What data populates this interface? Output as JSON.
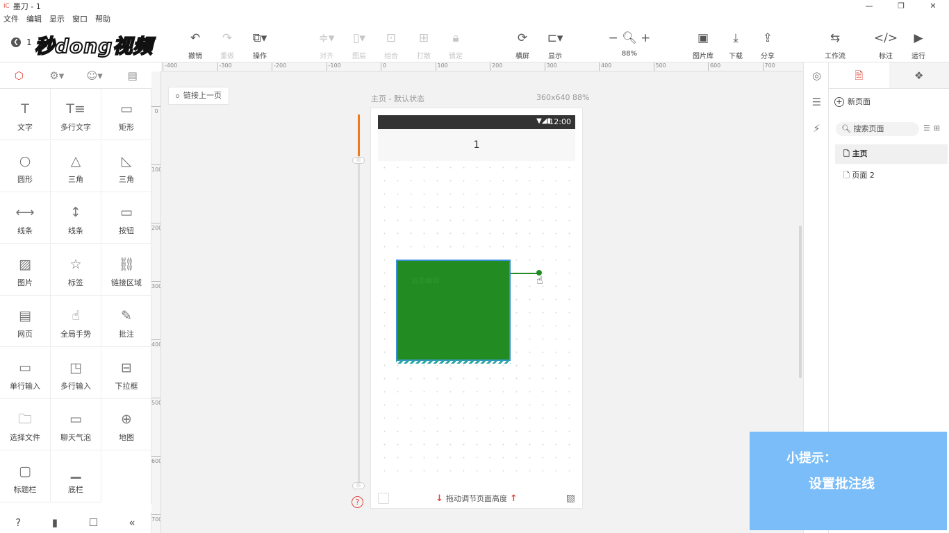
{
  "window": {
    "title": "墨刀 - 1",
    "logo": "iC",
    "minimize": "—",
    "restore": "❐",
    "close": "✕"
  },
  "menu": [
    "文件",
    "编辑",
    "显示",
    "窗口",
    "帮助"
  ],
  "brand": "秒dong视频",
  "page_number": "1",
  "toolbar": [
    {
      "label": "撤销",
      "icon": "↶",
      "disabled": false
    },
    {
      "label": "重做",
      "icon": "↷",
      "disabled": true
    },
    {
      "label": "操作",
      "icon": "⧉▾",
      "disabled": false
    },
    {
      "label": "对齐",
      "icon": "≑▾",
      "disabled": true
    },
    {
      "label": "图层",
      "icon": "▯▾",
      "disabled": true
    },
    {
      "label": "组合",
      "icon": "⊡",
      "disabled": true
    },
    {
      "label": "打散",
      "icon": "⊞",
      "disabled": true
    },
    {
      "label": "锁定",
      "icon": "🔒︎",
      "disabled": true
    },
    {
      "label": "横屏",
      "icon": "⟳",
      "disabled": false
    },
    {
      "label": "显示",
      "icon": "⊏▾",
      "disabled": false
    },
    {
      "label": "88%",
      "icon": "− 🔍︎ +",
      "disabled": false
    },
    {
      "label": "图片库",
      "icon": "▣",
      "disabled": false
    },
    {
      "label": "下载",
      "icon": "⤓",
      "disabled": false
    },
    {
      "label": "分享",
      "icon": "⇪",
      "disabled": false
    },
    {
      "label": "工作流",
      "icon": "⇆",
      "disabled": false
    },
    {
      "label": "标注",
      "icon": "</>",
      "disabled": false
    },
    {
      "label": "运行",
      "icon": "▶",
      "disabled": false
    }
  ],
  "left_tabs": [
    "⬡",
    "⚙▾",
    "☺▾",
    "▤"
  ],
  "palette": [
    {
      "label": "文字",
      "icon": "T"
    },
    {
      "label": "多行文字",
      "icon": "T≡"
    },
    {
      "label": "矩形",
      "icon": "▭"
    },
    {
      "label": "圆形",
      "icon": "○"
    },
    {
      "label": "三角",
      "icon": "△"
    },
    {
      "label": "三角",
      "icon": "◺"
    },
    {
      "label": "线条",
      "icon": "⟷"
    },
    {
      "label": "线条",
      "icon": "↕"
    },
    {
      "label": "按钮",
      "icon": "▭"
    },
    {
      "label": "图片",
      "icon": "▨"
    },
    {
      "label": "标签",
      "icon": "☆"
    },
    {
      "label": "链接区域",
      "icon": "⛓"
    },
    {
      "label": "网页",
      "icon": "▤"
    },
    {
      "label": "全局手势",
      "icon": "☝"
    },
    {
      "label": "批注",
      "icon": "✎"
    },
    {
      "label": "单行输入",
      "icon": "▭"
    },
    {
      "label": "多行输入",
      "icon": "◳"
    },
    {
      "label": "下拉框",
      "icon": "⊟"
    },
    {
      "label": "选择文件",
      "icon": "🗀"
    },
    {
      "label": "聊天气泡",
      "icon": "▭"
    },
    {
      "label": "地图",
      "icon": "⊕"
    },
    {
      "label": "标题栏",
      "icon": "▢"
    },
    {
      "label": "底栏",
      "icon": "▁"
    }
  ],
  "left_bottom": [
    "?",
    "▮",
    "☐",
    "«"
  ],
  "ruler_h": [
    "-400",
    "-300",
    "-200",
    "-100",
    "0",
    "100",
    "200",
    "300",
    "400",
    "500",
    "600",
    "700"
  ],
  "ruler_v": [
    "0",
    "100",
    "200",
    "300",
    "400",
    "500",
    "600",
    "700"
  ],
  "canvas": {
    "link_prev": "链接上一页",
    "artboard_label": "主页 - 默认状态",
    "artboard_size": "360x640 88%",
    "status_icons": "▼◢▮",
    "status_time": "12:00",
    "nav_title": "1",
    "box_text": "双击编辑",
    "footer_text": "拖动调节页面高度",
    "help": "?"
  },
  "right_strip": [
    "◎",
    "☰",
    "⚡"
  ],
  "right_tabs": [
    "🗎",
    "❖"
  ],
  "right_panel": {
    "new_page": "新页面",
    "search_placeholder": "搜索页面",
    "pages": [
      "主页",
      "页面 2"
    ]
  },
  "tip": {
    "line1": "小提示：",
    "line2": "设置批注线"
  }
}
